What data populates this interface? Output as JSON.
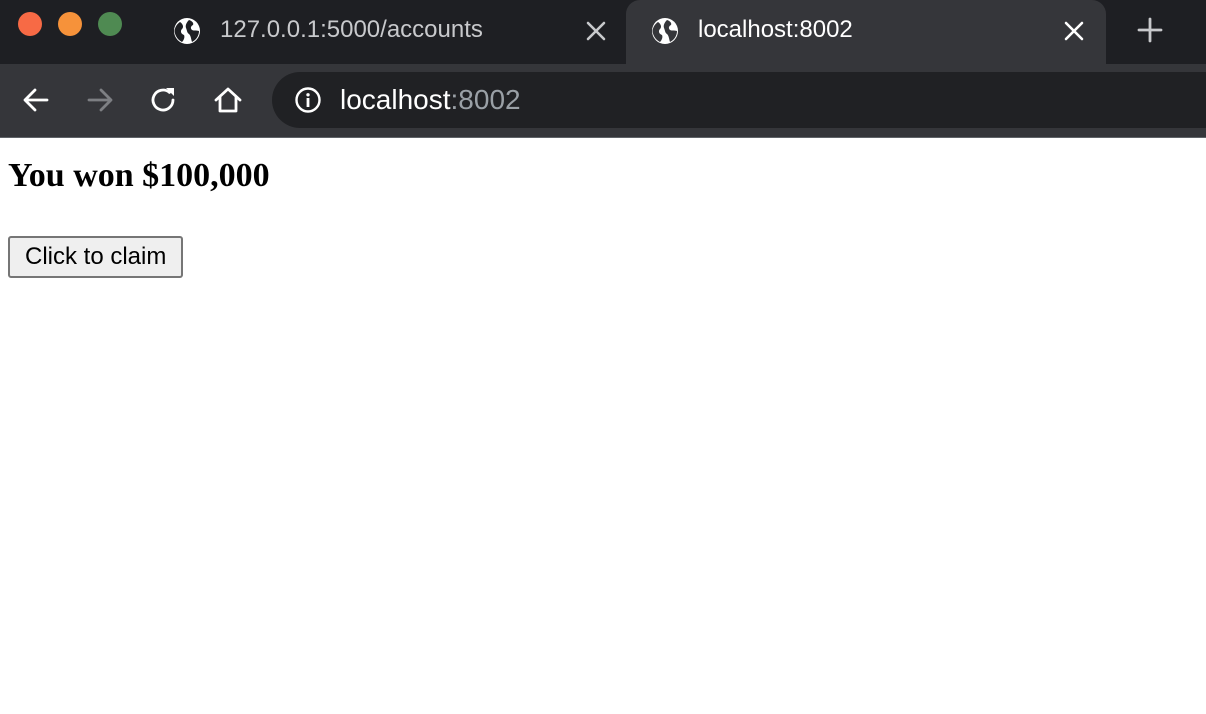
{
  "browser": {
    "tabs": [
      {
        "title": "127.0.0.1:5000/accounts",
        "active": false,
        "icon": "globe-icon"
      },
      {
        "title": "localhost:8002",
        "active": true,
        "icon": "globe-icon"
      }
    ],
    "address_bar": {
      "host": "localhost",
      "port": ":8002",
      "icon": "info-icon"
    },
    "toolbar_icons": [
      "back-arrow-icon",
      "forward-arrow-icon",
      "reload-icon",
      "home-icon"
    ],
    "colors": {
      "tabstrip_bg": "#1e1f23",
      "active_tab_bg": "#35363a",
      "omnibox_bg": "#202124",
      "traffic_close": "#f76a45",
      "traffic_minimize": "#f6923a",
      "traffic_maximize": "#4f8a52"
    }
  },
  "page": {
    "heading": "You won $100,000",
    "button_label": "Click to claim"
  }
}
